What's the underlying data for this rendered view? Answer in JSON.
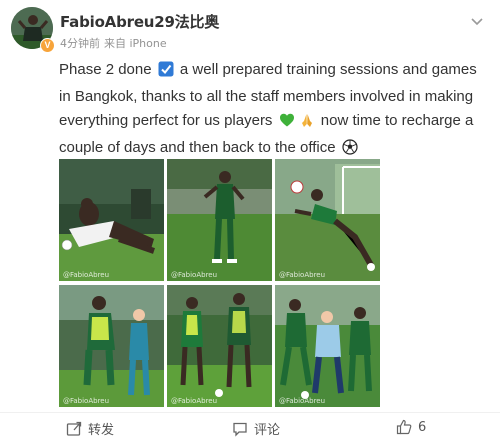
{
  "post": {
    "username": "FabioAbreu29法比奥",
    "time": "4分钟前",
    "source": "来自 iPhone",
    "more_icon": "chevron-down-icon",
    "text_parts": [
      "Phase 2 done",
      "a well prepared training sessions and games in Bangkok, thanks to all the staff members involved in making everything perfect for us players",
      "now time to recharge a couple of days and then back to the office"
    ],
    "icons": [
      "check-box-icon",
      "green-heart-icon",
      "folded-hands-icon",
      "soccer-ball-icon"
    ],
    "verified_badge": "V",
    "verified_color": "#f7a43a",
    "images": [
      {
        "name": "photo-players-stretching"
      },
      {
        "name": "photo-player-standing-field"
      },
      {
        "name": "photo-player-kicking-ball"
      },
      {
        "name": "photo-player-with-bib"
      },
      {
        "name": "photo-player-and-staff"
      },
      {
        "name": "photo-players-match"
      }
    ],
    "watermark": "@FabioAbreu"
  },
  "actions": {
    "repost_label": "转发",
    "comment_label": "评论",
    "like_count": "6"
  }
}
